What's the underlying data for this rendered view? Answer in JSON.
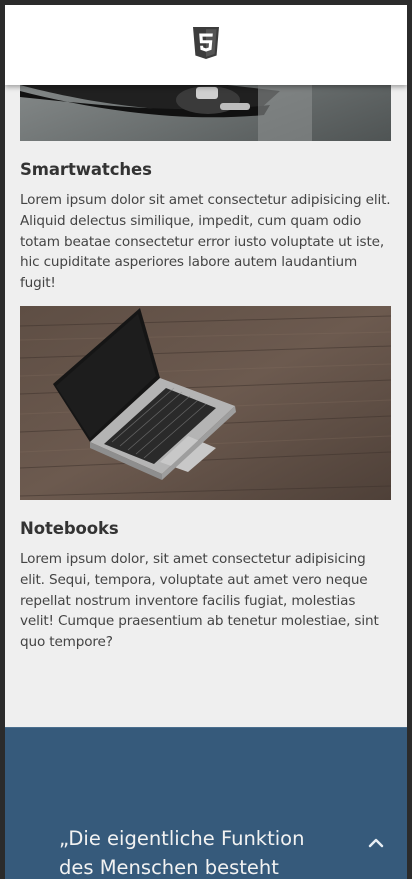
{
  "header": {
    "logo_icon": "html5-logo-icon"
  },
  "articles": [
    {
      "title": "Smartwatches",
      "text": "Lorem ipsum dolor sit amet consectetur adipisicing elit. Aliquid delectus similique, impedit, cum quam odio totam beatae consectetur error iusto voluptate ut iste, hic cupiditate asperiores labore autem laudantium fugit!"
    },
    {
      "title": "Notebooks",
      "text": "Lorem ipsum dolor, sit amet consectetur adipisicing elit. Sequi, tempora, voluptate aut amet vero neque repellat nostrum inventore facilis fugiat, molestias velit! Cumque praesentium ab tenetur molestiae, sint quo tempore?"
    }
  ],
  "footer": {
    "quote": "„Die eigentliche Funktion des Menschen besteht",
    "scroll_icon": "chevron-up-icon",
    "background": "#365a7b"
  }
}
